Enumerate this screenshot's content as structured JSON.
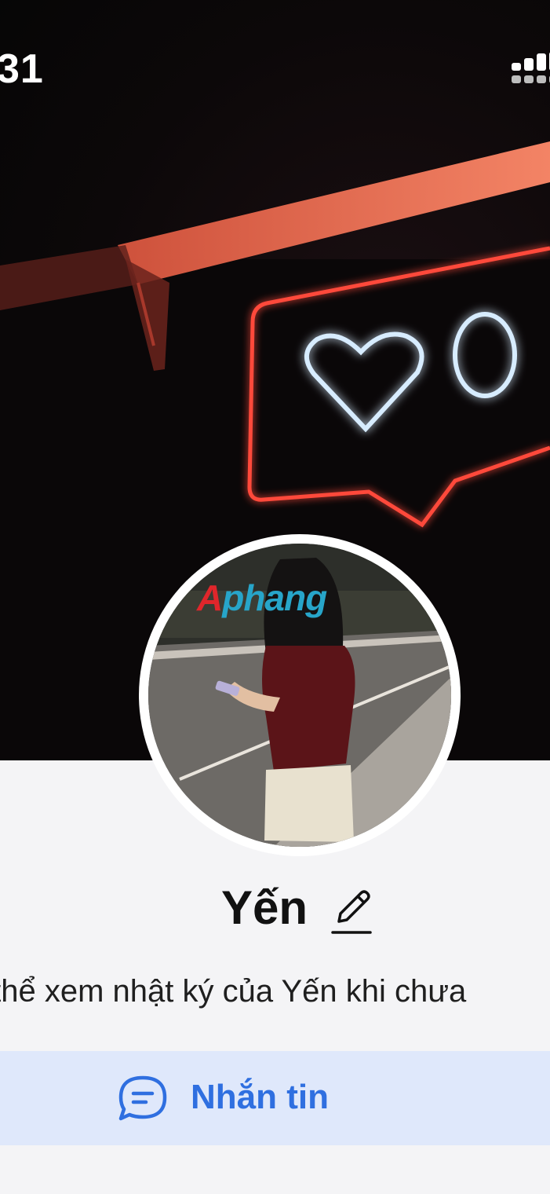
{
  "status_bar": {
    "time": "31",
    "signal_icon": "cellular-signal-icon"
  },
  "cover": {
    "description_icon": "neon-heart-sign",
    "neon_count": "0"
  },
  "avatar": {
    "watermark_prefix": "A",
    "watermark_rest": "phang"
  },
  "profile": {
    "name": "Yến",
    "edit_icon": "pencil-icon",
    "notice": "ưa thể xem nhật ký của Yến khi chưa"
  },
  "actions": {
    "message_label": "Nhắn tin",
    "message_icon": "chat-bubble-icon"
  },
  "colors": {
    "accent": "#2f6fe0",
    "button_bg": "#dfe8fb",
    "background": "#f4f4f6",
    "neon_red": "#ff4a3a",
    "neon_blue": "#cfe8ff"
  }
}
